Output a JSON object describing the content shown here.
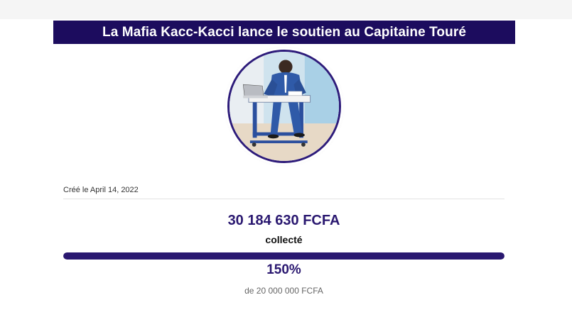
{
  "campaign": {
    "title": "La Mafia Kacc-Kacci lance le soutien au Capitaine Touré",
    "created_text": "Créé le April 14, 2022",
    "amount_collected": "30 184 630 FCFA",
    "collected_label": "collecté",
    "percent": "150%",
    "progress_fraction": 1.5,
    "goal_text": "de 20 000 000 FCFA"
  },
  "colors": {
    "brand": "#1c0c5e",
    "accent": "#2a1870"
  }
}
